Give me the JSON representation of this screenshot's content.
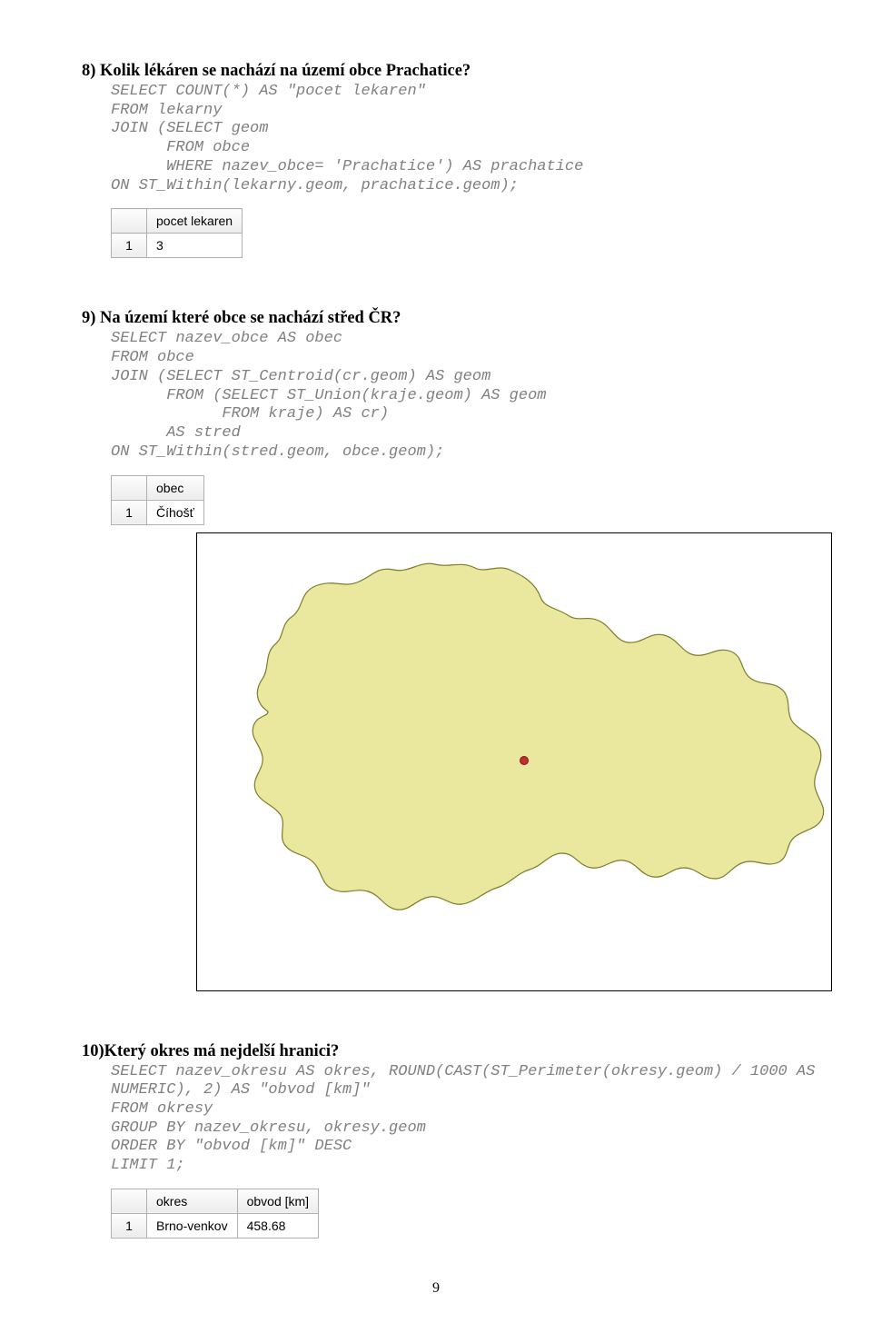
{
  "q8": {
    "heading": "8) Kolik lékáren se nachází na území obce Prachatice?",
    "sql": "SELECT COUNT(*) AS \"pocet lekaren\"\nFROM lekarny\nJOIN (SELECT geom\n      FROM obce\n      WHERE nazev_obce= 'Prachatice') AS prachatice\nON ST_Within(lekarny.geom, prachatice.geom);",
    "result": {
      "columns": [
        "pocet lekaren"
      ],
      "rows": [
        [
          "3"
        ]
      ]
    }
  },
  "q9": {
    "heading": "9) Na území které obce se nachází střed ČR?",
    "sql": "SELECT nazev_obce AS obec\nFROM obce\nJOIN (SELECT ST_Centroid(cr.geom) AS geom\n      FROM (SELECT ST_Union(kraje.geom) AS geom\n            FROM kraje) AS cr)\n      AS stred\nON ST_Within(stred.geom, obce.geom);",
    "result": {
      "columns": [
        "obec"
      ],
      "rows": [
        [
          "Číhošť"
        ]
      ]
    }
  },
  "q10": {
    "heading": "10)Který okres má nejdelší hranici?",
    "sql": "SELECT nazev_okresu AS okres, ROUND(CAST(ST_Perimeter(okresy.geom) / 1000 AS\nNUMERIC), 2) AS \"obvod [km]\"\nFROM okresy\nGROUP BY nazev_okresu, okresy.geom\nORDER BY \"obvod [km]\" DESC\nLIMIT 1;",
    "result": {
      "columns": [
        "okres",
        "obvod [km]"
      ],
      "rows": [
        [
          "Brno-venkov",
          "458.68"
        ]
      ]
    }
  },
  "page_number": "9"
}
